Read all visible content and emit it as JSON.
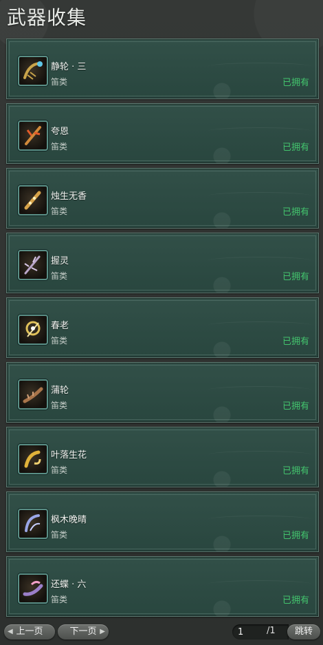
{
  "header": {
    "title": "武器收集"
  },
  "weapons": [
    {
      "name": "静轮 · 三",
      "type": "笛类",
      "status": "已拥有",
      "icon": "flute-weapon-icon-1",
      "icon_color": "#c9a44a"
    },
    {
      "name": "夸恩",
      "type": "笛类",
      "status": "已拥有",
      "icon": "flute-weapon-icon-2",
      "icon_color": "#d08a3a"
    },
    {
      "name": "烛生无香",
      "type": "笛类",
      "status": "已拥有",
      "icon": "flute-weapon-icon-3",
      "icon_color": "#d6a34a"
    },
    {
      "name": "握灵",
      "type": "笛类",
      "status": "已拥有",
      "icon": "flute-weapon-icon-4",
      "icon_color": "#b9a6c9"
    },
    {
      "name": "春老",
      "type": "笛类",
      "status": "已拥有",
      "icon": "flute-weapon-icon-5",
      "icon_color": "#e0c15a"
    },
    {
      "name": "蒲轮",
      "type": "笛类",
      "status": "已拥有",
      "icon": "flute-weapon-icon-6",
      "icon_color": "#a8744a"
    },
    {
      "name": "叶落生花",
      "type": "笛类",
      "status": "已拥有",
      "icon": "flute-weapon-icon-7",
      "icon_color": "#e0b23a"
    },
    {
      "name": "枫木晚晴",
      "type": "笛类",
      "status": "已拥有",
      "icon": "flute-weapon-icon-8",
      "icon_color": "#9aa6e6"
    },
    {
      "name": "还蝶 · 六",
      "type": "笛类",
      "status": "已拥有",
      "icon": "flute-weapon-icon-9",
      "icon_color": "#9b7fc9"
    }
  ],
  "pagination": {
    "prev_label": "上一页",
    "next_label": "下一页",
    "current_page": "1",
    "total_label": "/1",
    "jump_label": "跳转"
  },
  "colors": {
    "owned_status": "#43c46d",
    "card_bg": "#2b4a42",
    "card_border": "#5f7d74"
  }
}
